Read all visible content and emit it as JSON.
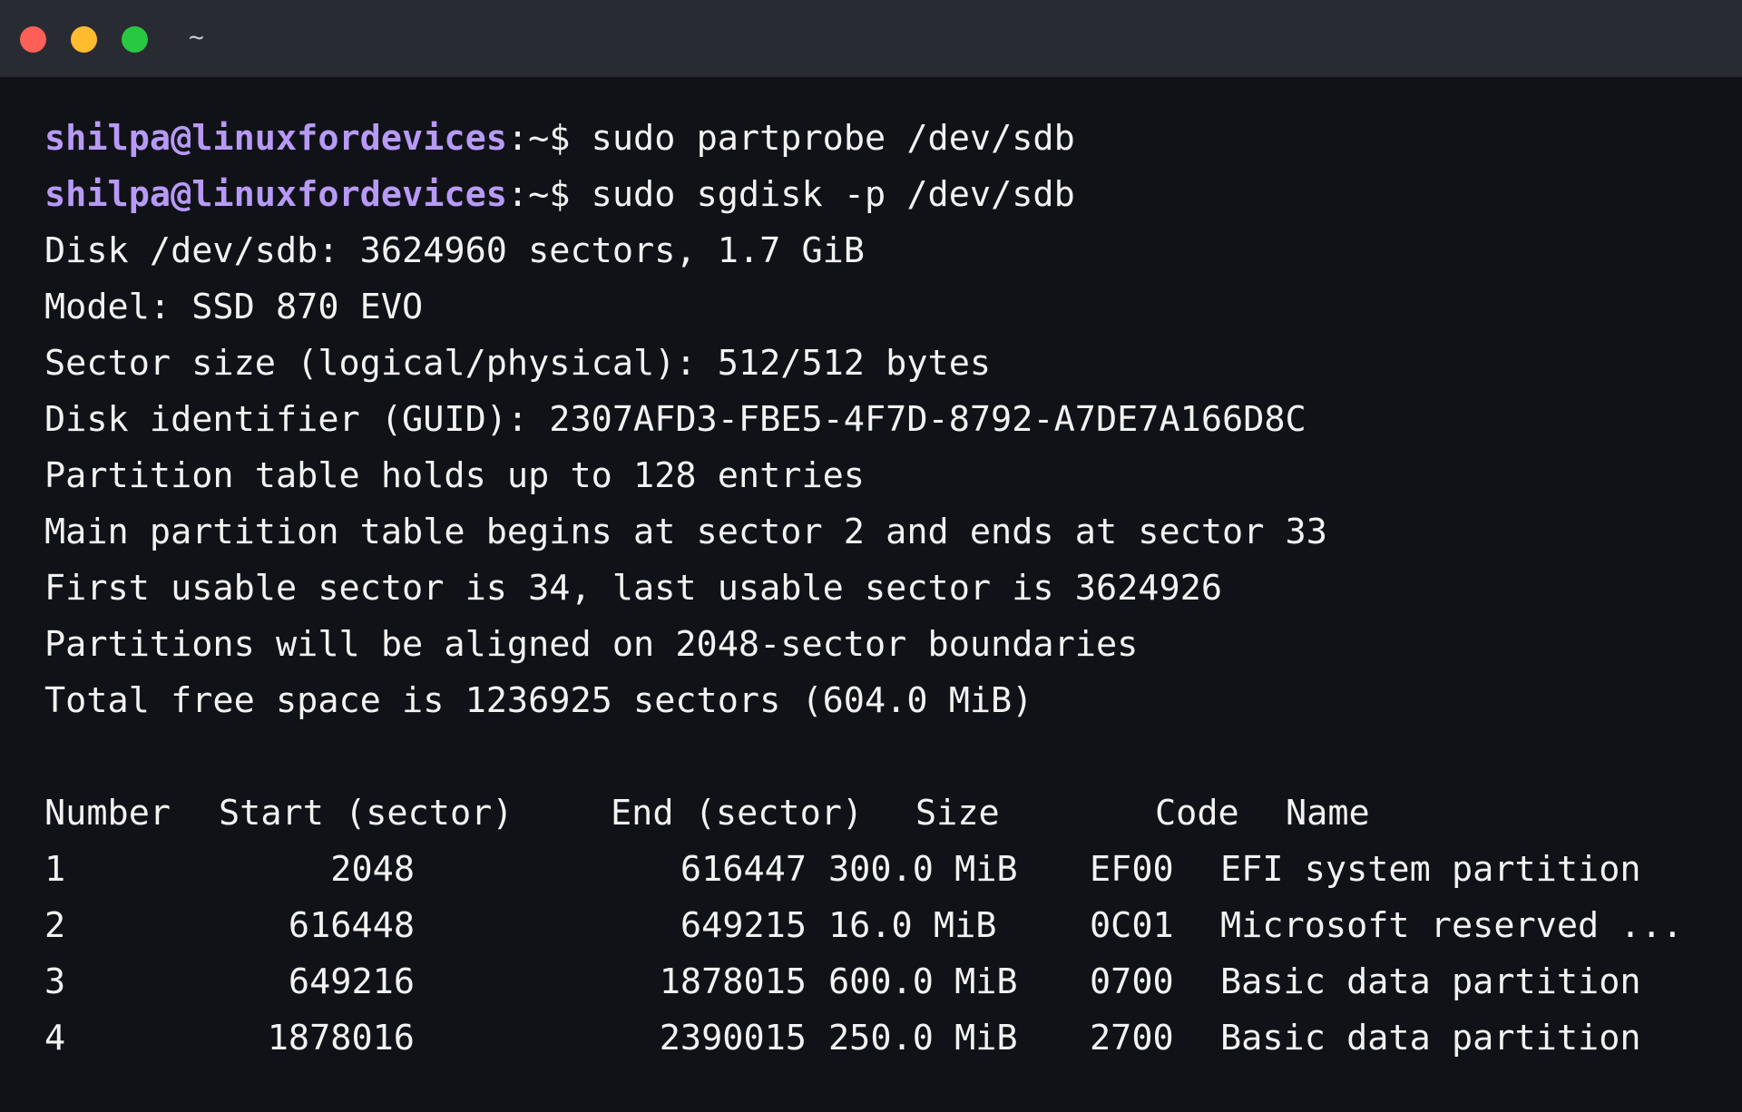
{
  "window": {
    "title": "~"
  },
  "terminal": {
    "prompts": [
      {
        "user_host": "shilpa@linuxfordevices",
        "path_symbol": ":~$",
        "command": "sudo partprobe /dev/sdb"
      },
      {
        "user_host": "shilpa@linuxfordevices",
        "path_symbol": ":~$",
        "command": "sudo sgdisk -p /dev/sdb"
      }
    ],
    "output_lines": [
      "Disk /dev/sdb: 3624960 sectors, 1.7 GiB",
      "Model: SSD 870 EVO",
      "Sector size (logical/physical): 512/512 bytes",
      "Disk identifier (GUID): 2307AFD3-FBE5-4F7D-8792-A7DE7A166D8C",
      "Partition table holds up to 128 entries",
      "Main partition table begins at sector 2 and ends at sector 33",
      "First usable sector is 34, last usable sector is 3624926",
      "Partitions will be aligned on 2048-sector boundaries",
      "Total free space is 1236925 sectors (604.0 MiB)"
    ],
    "table": {
      "headers": {
        "number": "Number",
        "start": "Start (sector)",
        "end": "End (sector)",
        "size": "Size",
        "code": "Code",
        "name": "Name"
      },
      "rows": [
        {
          "number": "1",
          "start": "2048",
          "end": "616447",
          "size": "300.0 MiB",
          "code": "EF00",
          "name": "EFI system partition"
        },
        {
          "number": "2",
          "start": "616448",
          "end": "649215",
          "size": "16.0 MiB",
          "code": "0C01",
          "name": "Microsoft reserved ..."
        },
        {
          "number": "3",
          "start": "649216",
          "end": "1878015",
          "size": "600.0 MiB",
          "code": "0700",
          "name": "Basic data partition"
        },
        {
          "number": "4",
          "start": "1878016",
          "end": "2390015",
          "size": "250.0 MiB",
          "code": "2700",
          "name": "Basic data partition"
        }
      ]
    }
  },
  "colors": {
    "background": "#111217",
    "titlebar": "#292b33",
    "prompt_user": "#b79af7",
    "text": "#f2f2f2",
    "close": "#fe5f57",
    "minimize": "#febc2e",
    "maximize": "#28c840"
  }
}
